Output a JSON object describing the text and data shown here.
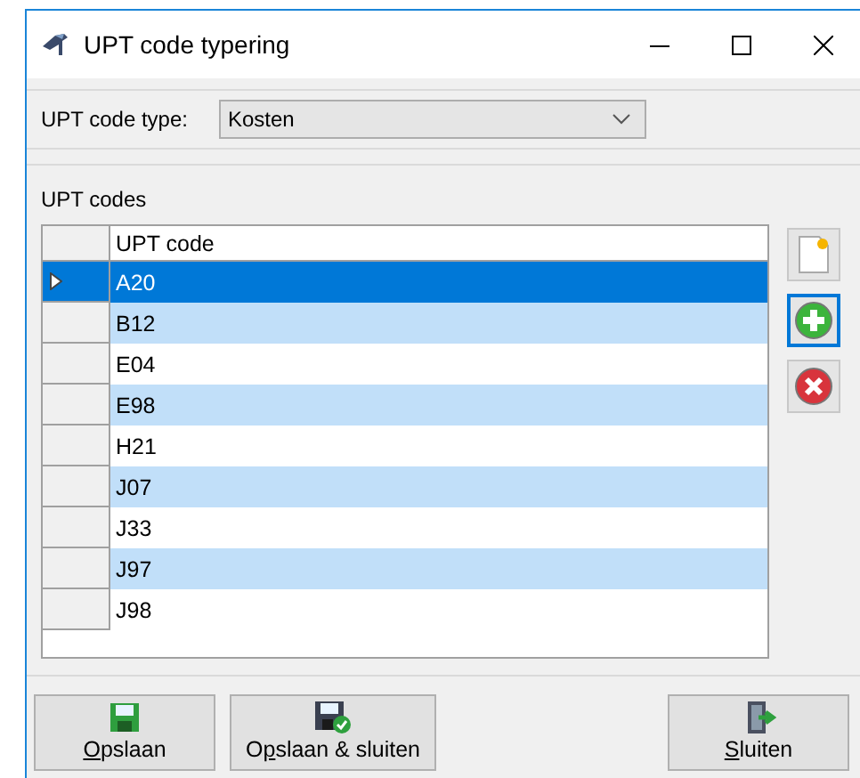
{
  "window": {
    "title": "UPT code typering"
  },
  "code_type": {
    "label": "UPT code type:",
    "value": "Kosten"
  },
  "codes_group": {
    "label": "UPT codes"
  },
  "table": {
    "columns": [
      "UPT code"
    ],
    "rows": [
      {
        "code": "A20",
        "selected": true
      },
      {
        "code": "B12",
        "selected": false
      },
      {
        "code": "E04",
        "selected": false
      },
      {
        "code": "E98",
        "selected": false
      },
      {
        "code": "H21",
        "selected": false
      },
      {
        "code": "J07",
        "selected": false
      },
      {
        "code": "J33",
        "selected": false
      },
      {
        "code": "J97",
        "selected": false
      },
      {
        "code": "J98",
        "selected": false
      }
    ]
  },
  "side_buttons": [
    {
      "kind": "new",
      "focused": false
    },
    {
      "kind": "add",
      "focused": true
    },
    {
      "kind": "delete",
      "focused": false
    }
  ],
  "buttons": [
    {
      "kind": "save",
      "mnemonic": "O",
      "after": "pslaan"
    },
    {
      "kind": "save_close",
      "before": "O",
      "mnemonic": "p",
      "after": "slaan & sluiten"
    },
    {
      "kind": "close",
      "mnemonic": "S",
      "after": "luiten"
    }
  ]
}
